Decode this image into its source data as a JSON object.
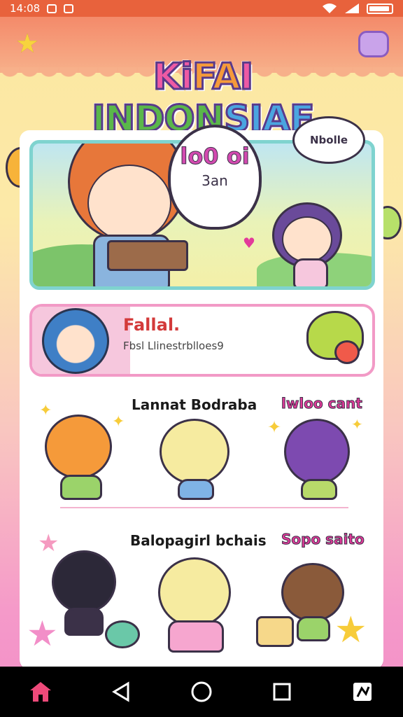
{
  "status_bar": {
    "time": "14:08"
  },
  "app": {
    "title_parts": [
      "Ki",
      "FA",
      "I ",
      "INDON",
      "SIAE"
    ]
  },
  "hero": {
    "speech_main": "lo0 oi",
    "speech_sub": "3an",
    "speech_small": "Nbolle"
  },
  "profile": {
    "name": "Fallal.",
    "description": "Fbsl Llinestrblloes9"
  },
  "sections": [
    {
      "title": "Lannat Bodraba",
      "link": "lwloo cant"
    },
    {
      "title": "Balopagirl bchais",
      "link": "Sopo saito"
    }
  ],
  "colors": {
    "accent": "#e8623c",
    "pink": "#f29ac6",
    "teal": "#7fd3cf",
    "link": "#e23a9a"
  },
  "nav": {
    "items": [
      "home-icon",
      "back-icon",
      "circle-home-icon",
      "recents-icon",
      "app-icon"
    ]
  }
}
